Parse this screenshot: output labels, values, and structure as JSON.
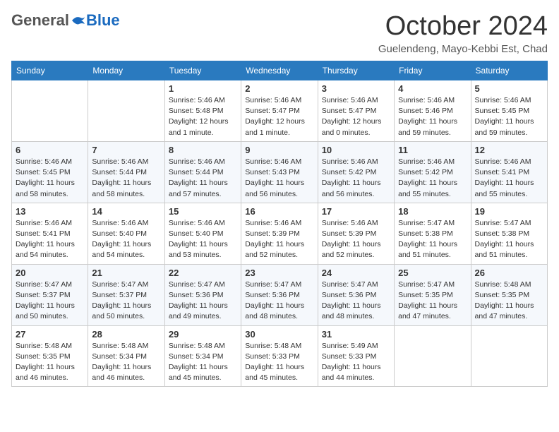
{
  "header": {
    "logo_general": "General",
    "logo_blue": "Blue",
    "month_title": "October 2024",
    "location": "Guelendeng, Mayo-Kebbi Est, Chad"
  },
  "calendar": {
    "days_of_week": [
      "Sunday",
      "Monday",
      "Tuesday",
      "Wednesday",
      "Thursday",
      "Friday",
      "Saturday"
    ],
    "weeks": [
      [
        {
          "day": "",
          "content": ""
        },
        {
          "day": "",
          "content": ""
        },
        {
          "day": "1",
          "content": "Sunrise: 5:46 AM\nSunset: 5:48 PM\nDaylight: 12 hours and 1 minute."
        },
        {
          "day": "2",
          "content": "Sunrise: 5:46 AM\nSunset: 5:47 PM\nDaylight: 12 hours and 1 minute."
        },
        {
          "day": "3",
          "content": "Sunrise: 5:46 AM\nSunset: 5:47 PM\nDaylight: 12 hours and 0 minutes."
        },
        {
          "day": "4",
          "content": "Sunrise: 5:46 AM\nSunset: 5:46 PM\nDaylight: 11 hours and 59 minutes."
        },
        {
          "day": "5",
          "content": "Sunrise: 5:46 AM\nSunset: 5:45 PM\nDaylight: 11 hours and 59 minutes."
        }
      ],
      [
        {
          "day": "6",
          "content": "Sunrise: 5:46 AM\nSunset: 5:45 PM\nDaylight: 11 hours and 58 minutes."
        },
        {
          "day": "7",
          "content": "Sunrise: 5:46 AM\nSunset: 5:44 PM\nDaylight: 11 hours and 58 minutes."
        },
        {
          "day": "8",
          "content": "Sunrise: 5:46 AM\nSunset: 5:44 PM\nDaylight: 11 hours and 57 minutes."
        },
        {
          "day": "9",
          "content": "Sunrise: 5:46 AM\nSunset: 5:43 PM\nDaylight: 11 hours and 56 minutes."
        },
        {
          "day": "10",
          "content": "Sunrise: 5:46 AM\nSunset: 5:42 PM\nDaylight: 11 hours and 56 minutes."
        },
        {
          "day": "11",
          "content": "Sunrise: 5:46 AM\nSunset: 5:42 PM\nDaylight: 11 hours and 55 minutes."
        },
        {
          "day": "12",
          "content": "Sunrise: 5:46 AM\nSunset: 5:41 PM\nDaylight: 11 hours and 55 minutes."
        }
      ],
      [
        {
          "day": "13",
          "content": "Sunrise: 5:46 AM\nSunset: 5:41 PM\nDaylight: 11 hours and 54 minutes."
        },
        {
          "day": "14",
          "content": "Sunrise: 5:46 AM\nSunset: 5:40 PM\nDaylight: 11 hours and 54 minutes."
        },
        {
          "day": "15",
          "content": "Sunrise: 5:46 AM\nSunset: 5:40 PM\nDaylight: 11 hours and 53 minutes."
        },
        {
          "day": "16",
          "content": "Sunrise: 5:46 AM\nSunset: 5:39 PM\nDaylight: 11 hours and 52 minutes."
        },
        {
          "day": "17",
          "content": "Sunrise: 5:46 AM\nSunset: 5:39 PM\nDaylight: 11 hours and 52 minutes."
        },
        {
          "day": "18",
          "content": "Sunrise: 5:47 AM\nSunset: 5:38 PM\nDaylight: 11 hours and 51 minutes."
        },
        {
          "day": "19",
          "content": "Sunrise: 5:47 AM\nSunset: 5:38 PM\nDaylight: 11 hours and 51 minutes."
        }
      ],
      [
        {
          "day": "20",
          "content": "Sunrise: 5:47 AM\nSunset: 5:37 PM\nDaylight: 11 hours and 50 minutes."
        },
        {
          "day": "21",
          "content": "Sunrise: 5:47 AM\nSunset: 5:37 PM\nDaylight: 11 hours and 50 minutes."
        },
        {
          "day": "22",
          "content": "Sunrise: 5:47 AM\nSunset: 5:36 PM\nDaylight: 11 hours and 49 minutes."
        },
        {
          "day": "23",
          "content": "Sunrise: 5:47 AM\nSunset: 5:36 PM\nDaylight: 11 hours and 48 minutes."
        },
        {
          "day": "24",
          "content": "Sunrise: 5:47 AM\nSunset: 5:36 PM\nDaylight: 11 hours and 48 minutes."
        },
        {
          "day": "25",
          "content": "Sunrise: 5:47 AM\nSunset: 5:35 PM\nDaylight: 11 hours and 47 minutes."
        },
        {
          "day": "26",
          "content": "Sunrise: 5:48 AM\nSunset: 5:35 PM\nDaylight: 11 hours and 47 minutes."
        }
      ],
      [
        {
          "day": "27",
          "content": "Sunrise: 5:48 AM\nSunset: 5:35 PM\nDaylight: 11 hours and 46 minutes."
        },
        {
          "day": "28",
          "content": "Sunrise: 5:48 AM\nSunset: 5:34 PM\nDaylight: 11 hours and 46 minutes."
        },
        {
          "day": "29",
          "content": "Sunrise: 5:48 AM\nSunset: 5:34 PM\nDaylight: 11 hours and 45 minutes."
        },
        {
          "day": "30",
          "content": "Sunrise: 5:48 AM\nSunset: 5:33 PM\nDaylight: 11 hours and 45 minutes."
        },
        {
          "day": "31",
          "content": "Sunrise: 5:49 AM\nSunset: 5:33 PM\nDaylight: 11 hours and 44 minutes."
        },
        {
          "day": "",
          "content": ""
        },
        {
          "day": "",
          "content": ""
        }
      ]
    ]
  }
}
